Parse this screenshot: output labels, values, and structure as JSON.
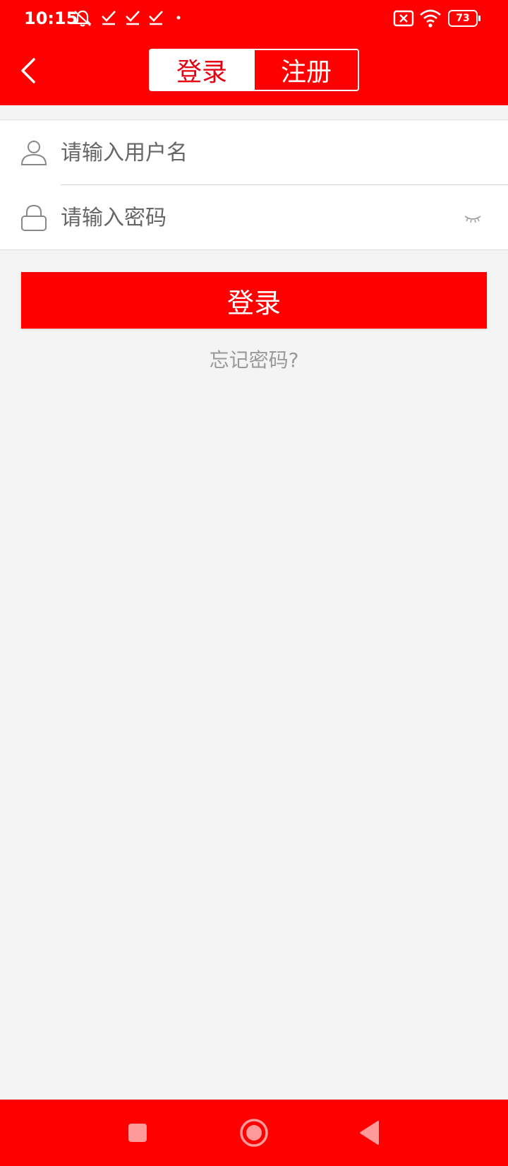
{
  "status_bar": {
    "time": "10:15",
    "battery": "73",
    "icons": [
      "notification-muted-icon",
      "check-icon",
      "check-icon",
      "check-icon",
      "dot-icon",
      "no-sim-icon",
      "wifi-icon",
      "battery-icon"
    ]
  },
  "toolbar": {
    "back_icon": "back-arrow-icon",
    "tabs": [
      {
        "label": "登录",
        "active": true
      },
      {
        "label": "注册",
        "active": false
      }
    ]
  },
  "form": {
    "username": {
      "placeholder": "请输入用户名",
      "value": "",
      "icon": "user-icon"
    },
    "password": {
      "placeholder": "请输入密码",
      "value": "",
      "icon": "lock-icon",
      "toggle_icon": "eye-closed-icon"
    }
  },
  "login_button": {
    "label": "登录"
  },
  "forgot_link": {
    "label": "忘记密码?"
  },
  "nav_bar": {
    "buttons": [
      "recents-square-icon",
      "home-circle-icon",
      "back-triangle-icon"
    ]
  },
  "colors": {
    "brand_red": "#ff0000",
    "active_tab_text": "#e60012",
    "background": "#f4f4f4",
    "hint_text": "#999999"
  }
}
